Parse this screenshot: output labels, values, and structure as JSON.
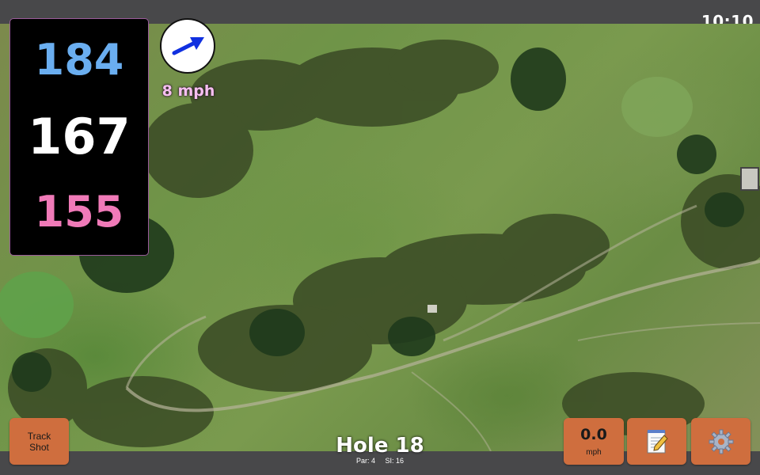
{
  "status_bar": {
    "time": "10:10"
  },
  "distances": {
    "back": "184",
    "middle": "167",
    "front": "155"
  },
  "wind": {
    "speed_label": "8 mph",
    "icon": "arrow-icon"
  },
  "hole": {
    "title": "Hole 18",
    "par": "Par: 4",
    "stroke_index": "SI: 16"
  },
  "buttons": {
    "track_shot_line1": "Track",
    "track_shot_line2": "Shot",
    "speed_value": "0.0",
    "speed_unit": "mph",
    "notes_icon": "notepad-icon",
    "settings_icon": "gear-icon"
  },
  "colors": {
    "back_distance": "#6aaef0",
    "middle_distance": "#ffffff",
    "front_distance": "#f07ab8",
    "button": "#cf6e3e",
    "wind_arrow": "#1030e0"
  }
}
